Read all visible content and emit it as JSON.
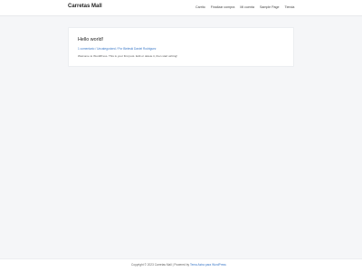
{
  "header": {
    "site_title": "Carretas Mall",
    "nav": [
      {
        "label": "Carrito"
      },
      {
        "label": "Finalizar compra"
      },
      {
        "label": "Mi cuenta"
      },
      {
        "label": "Sample Page"
      },
      {
        "label": "Tienda"
      }
    ]
  },
  "post": {
    "title": "Hello world!",
    "meta": {
      "comments": "1 comentario",
      "separator_1": "/",
      "category": "Uncategorized",
      "separator_2": "/",
      "author": "Por Bieleski Daniel Rodriguez"
    },
    "excerpt": "Welcome to WordPress. This is your first post. Edit or delete it, then start writing!"
  },
  "footer": {
    "copyright": "Copyright © 2023 Carretas Mall",
    "separator": "|",
    "powered_by": "Powered by",
    "theme_link": "Tema Astra para WordPress"
  }
}
